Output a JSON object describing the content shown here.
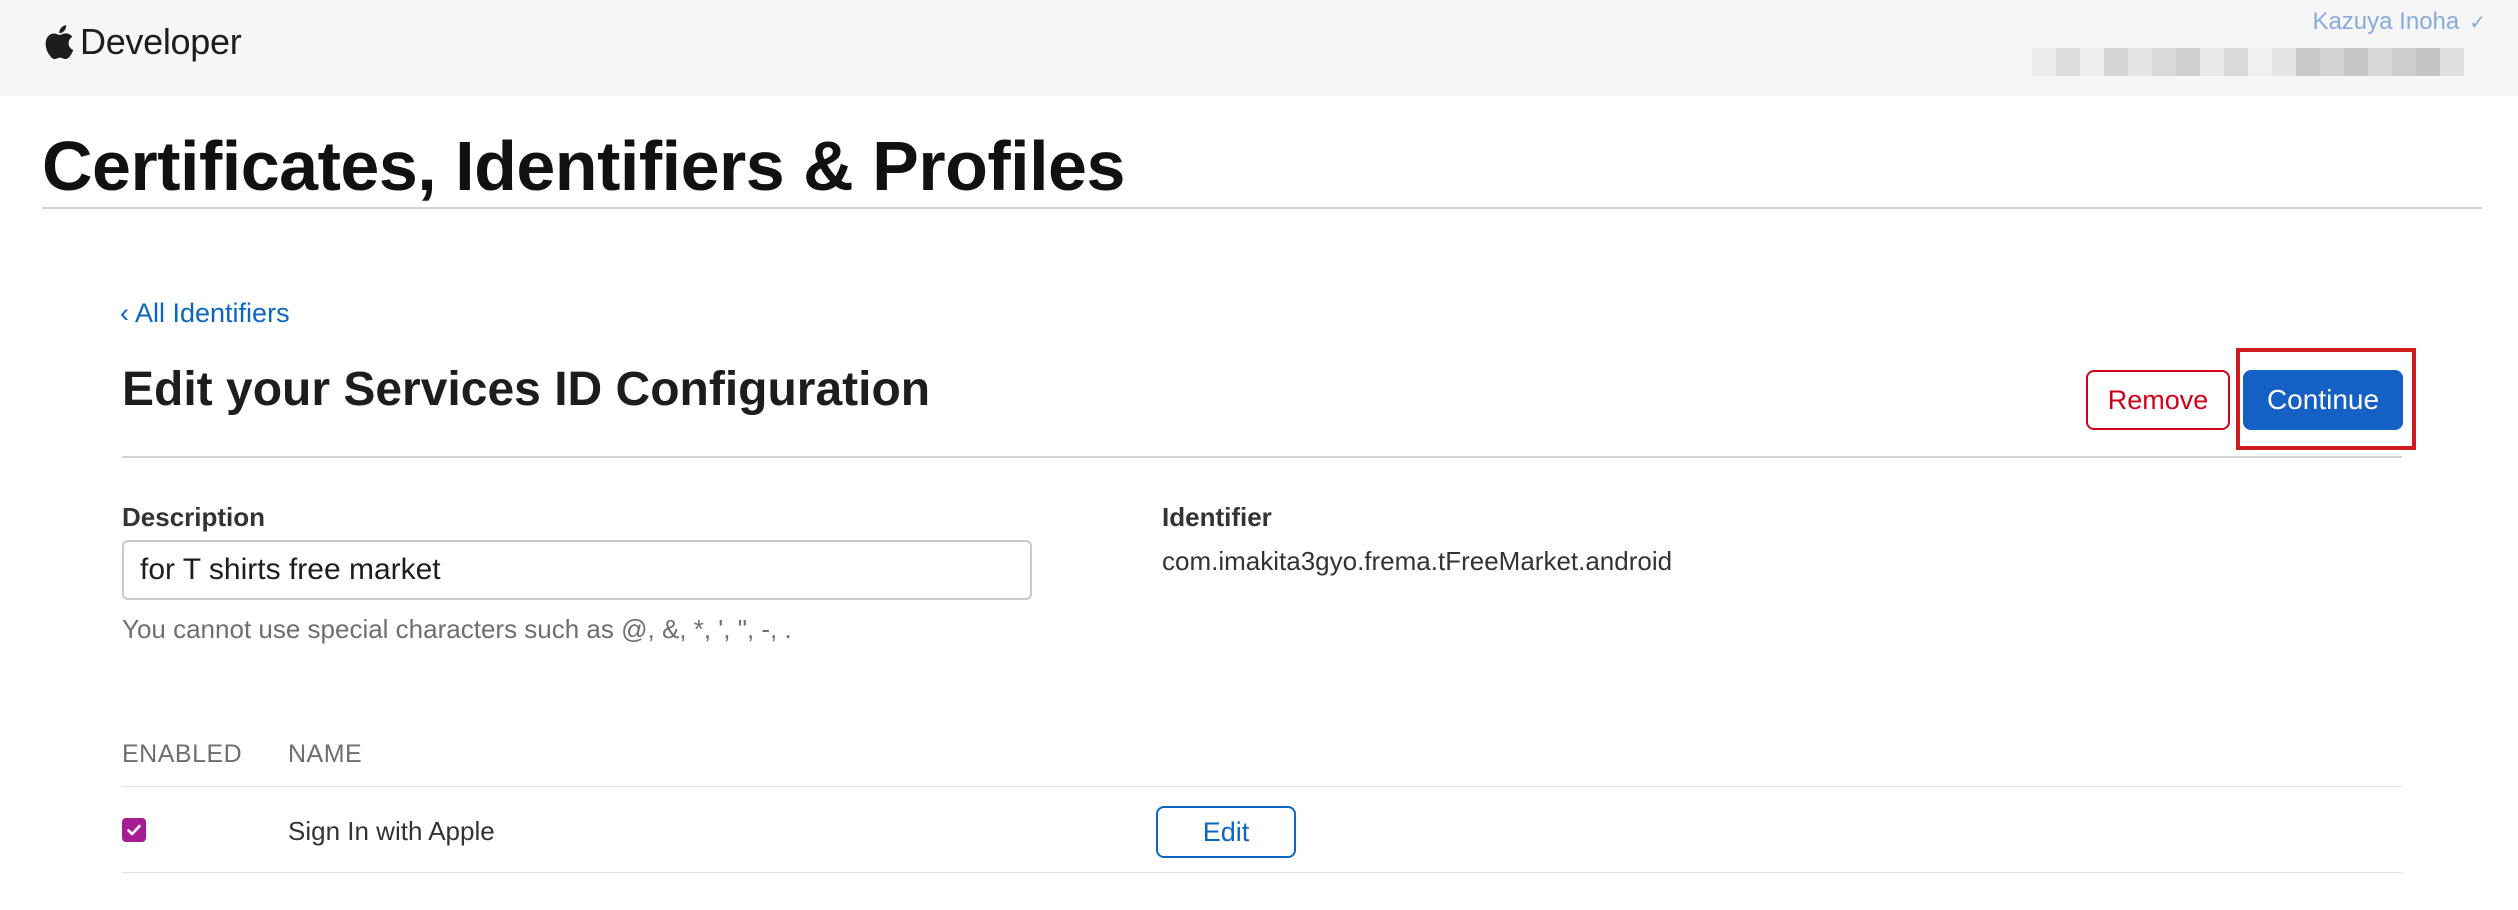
{
  "header": {
    "brand": "Developer",
    "account_name": "Kazuya Inoha",
    "account_chevron": "✓",
    "team_blur_colors": [
      "#ececec",
      "#dcdcdc",
      "#efefef",
      "#d6d6d6",
      "#e4e4e4",
      "#dadada",
      "#cfcfcf",
      "#e9e9e9",
      "#d9d9d9",
      "#f0f0f0",
      "#e5e5e5",
      "#c9c9c9",
      "#d3d3d3",
      "#c6c6c6",
      "#d8d8d8",
      "#cccccc",
      "#c4c4c4",
      "#e0e0e0"
    ]
  },
  "page": {
    "title": "Certificates, Identifiers & Profiles"
  },
  "nav": {
    "back_link": "‹ All Identifiers"
  },
  "section": {
    "title": "Edit your Services ID Configuration",
    "remove_label": "Remove",
    "continue_label": "Continue"
  },
  "form": {
    "description_label": "Description",
    "description_value": "for T shirts free market",
    "description_help": "You cannot use special characters such as @, &, *, ', \", -, .",
    "identifier_label": "Identifier",
    "identifier_value": "com.imakita3gyo.frema.tFreeMarket.android"
  },
  "capabilities": {
    "headers": {
      "enabled": "ENABLED",
      "name": "NAME"
    },
    "rows": [
      {
        "enabled": true,
        "name": "Sign In with Apple",
        "action_label": "Edit"
      }
    ]
  },
  "colors": {
    "link": "#0a66c2",
    "primary": "#1560c4",
    "destructive": "#d0021b",
    "highlight": "#d11a1a",
    "checkbox": "#a51d93"
  }
}
